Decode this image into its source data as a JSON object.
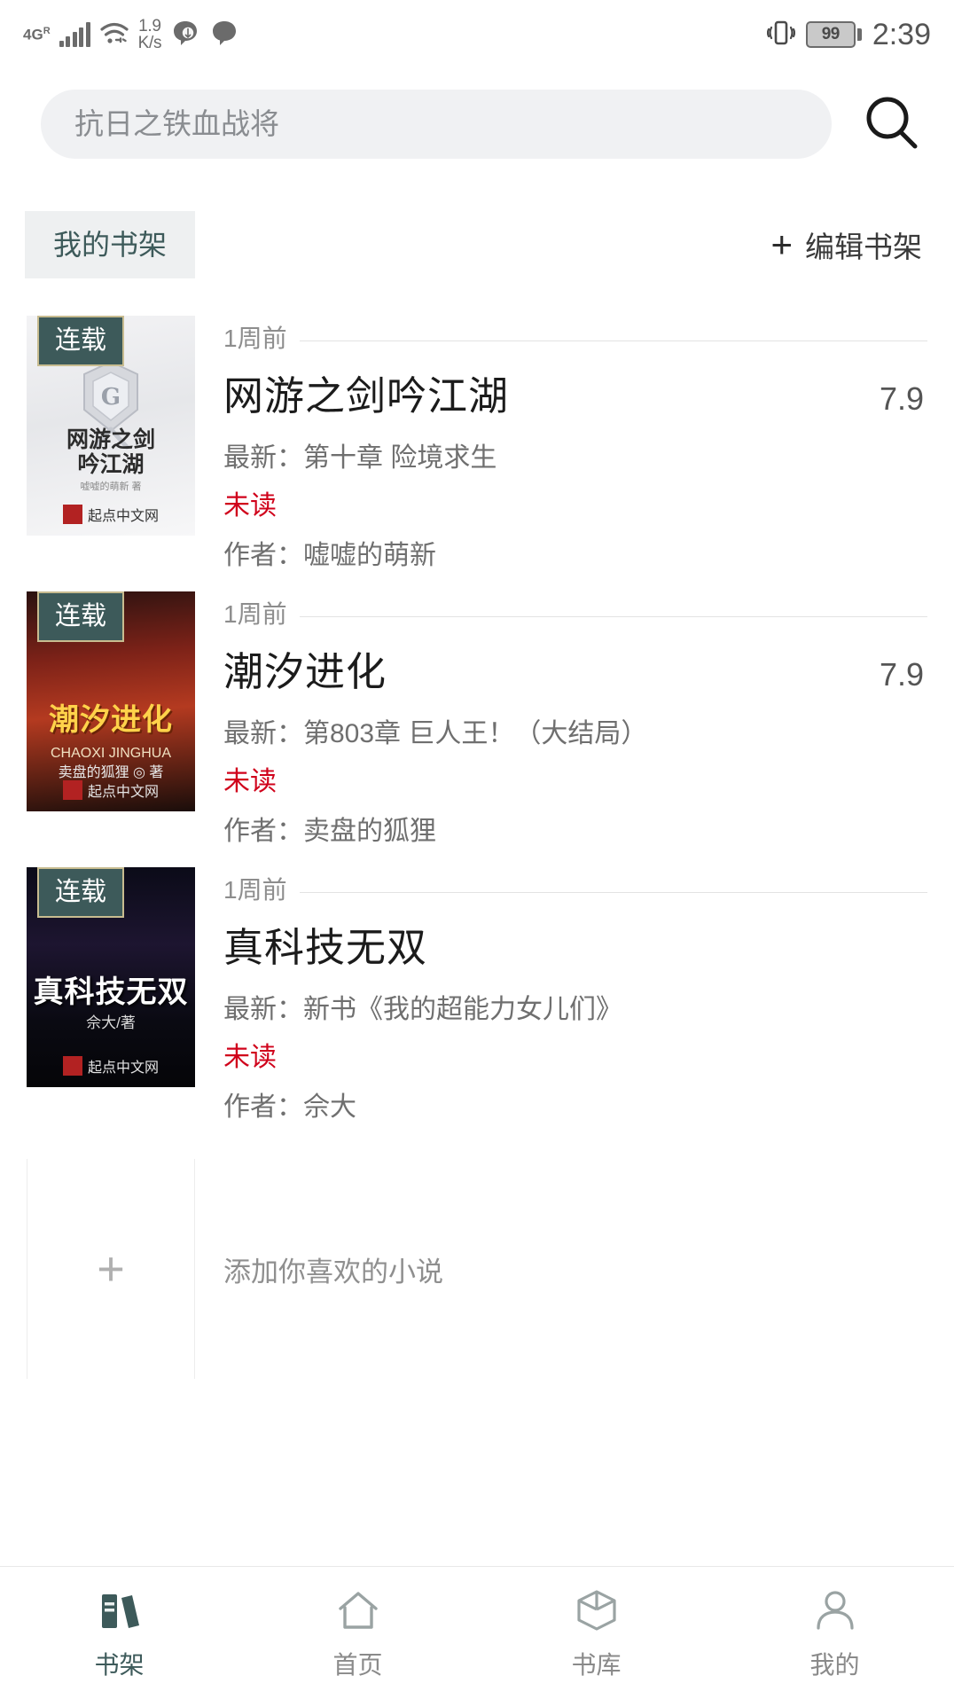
{
  "statusbar": {
    "network_type": "4G",
    "roaming": "R",
    "speed_value": "1.9",
    "speed_unit": "K/s",
    "battery_percent": "99",
    "clock": "2:39",
    "icons": [
      "signal-icon",
      "wifi-icon",
      "message-bubble-icon",
      "message-bubble-icon",
      "vibrate-icon",
      "battery-icon"
    ]
  },
  "search": {
    "value": "",
    "placeholder": "抗日之铁血战将",
    "button_icon": "search-icon"
  },
  "shelf_header": {
    "tab_label": "我的书架",
    "edit_plus": "+",
    "edit_label": "编辑书架"
  },
  "books": [
    {
      "badge": "连载",
      "time_ago": "1周前",
      "title": "网游之剑吟江湖",
      "rating": "7.9",
      "latest": "最新：第十章 险境求生",
      "unread": "未读",
      "author": "作者：嘘嘘的萌新",
      "cover_title": "网游之剑\n吟江湖",
      "cover_author": "嘘嘘的萌新 著",
      "cover_publisher": "起点中文网"
    },
    {
      "badge": "连载",
      "time_ago": "1周前",
      "title": "潮汐进化",
      "rating": "7.9",
      "latest": "最新：第803章 巨人王！（大结局）",
      "unread": "未读",
      "author": "作者：卖盘的狐狸",
      "cover_title": "潮汐进化",
      "cover_pinyin": "CHAOXI JINGHUA",
      "cover_author": "卖盘的狐狸 ◎ 著",
      "cover_publisher": "起点中文网"
    },
    {
      "badge": "连载",
      "time_ago": "1周前",
      "title": "真科技无双",
      "rating": "",
      "latest": "最新：新书《我的超能力女儿们》",
      "unread": "未读",
      "author": "作者：佘大",
      "cover_title": "真科技无双",
      "cover_author": "佘大/著",
      "cover_publisher": "起点中文网"
    }
  ],
  "add_row": {
    "plus": "+",
    "label": "添加你喜欢的小说"
  },
  "bottomnav": {
    "items": [
      {
        "label": "书架",
        "icon": "books-icon",
        "active": true
      },
      {
        "label": "首页",
        "icon": "home-icon",
        "active": false
      },
      {
        "label": "书库",
        "icon": "cube-icon",
        "active": false
      },
      {
        "label": "我的",
        "icon": "person-icon",
        "active": false
      }
    ]
  },
  "colors": {
    "accent": "#3d5a5a",
    "unread": "#d0021b",
    "muted": "#8d8d8d",
    "chip_bg": "#eef0f1"
  }
}
